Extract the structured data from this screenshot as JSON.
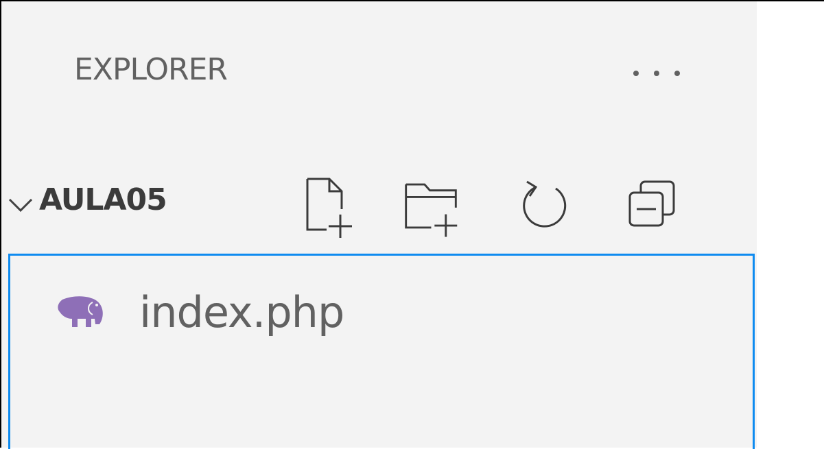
{
  "explorer": {
    "title": "EXPLORER",
    "more_icon": "ellipsis-icon"
  },
  "folder": {
    "name": "AULA05",
    "expanded": true,
    "chevron_icon": "chevron-down-icon",
    "actions": [
      {
        "icon": "new-file-icon"
      },
      {
        "icon": "new-folder-icon"
      },
      {
        "icon": "refresh-icon"
      },
      {
        "icon": "collapse-all-icon"
      }
    ]
  },
  "files": [
    {
      "name": "index.php",
      "icon": "php-elephant-icon"
    }
  ],
  "colors": {
    "sidebar_bg": "#f3f3f3",
    "text_muted": "#616161",
    "text_strong": "#3b3b3b",
    "focus_border": "#0e8bf0",
    "php_icon": "#8e6fb7"
  }
}
